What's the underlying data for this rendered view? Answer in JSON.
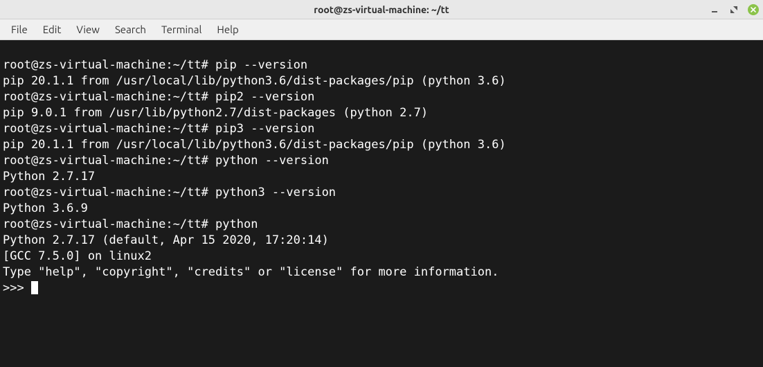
{
  "window": {
    "title": "root@zs-virtual-machine: ~/tt"
  },
  "menubar": {
    "items": [
      "File",
      "Edit",
      "View",
      "Search",
      "Terminal",
      "Help"
    ]
  },
  "terminal": {
    "prompt": "root@zs-virtual-machine:~/tt# ",
    "pyprompt": ">>> ",
    "commands": [
      {
        "cmd": "pip --version",
        "out": [
          "pip 20.1.1 from /usr/local/lib/python3.6/dist-packages/pip (python 3.6)"
        ]
      },
      {
        "cmd": "pip2 --version",
        "out": [
          "pip 9.0.1 from /usr/lib/python2.7/dist-packages (python 2.7)"
        ]
      },
      {
        "cmd": "pip3 --version",
        "out": [
          "pip 20.1.1 from /usr/local/lib/python3.6/dist-packages/pip (python 3.6)"
        ]
      },
      {
        "cmd": "python --version",
        "out": [
          "Python 2.7.17"
        ]
      },
      {
        "cmd": "python3 --version",
        "out": [
          "Python 3.6.9"
        ]
      },
      {
        "cmd": "python",
        "out": [
          "Python 2.7.17 (default, Apr 15 2020, 17:20:14) ",
          "[GCC 7.5.0] on linux2",
          "Type \"help\", \"copyright\", \"credits\" or \"license\" for more information."
        ]
      }
    ]
  }
}
